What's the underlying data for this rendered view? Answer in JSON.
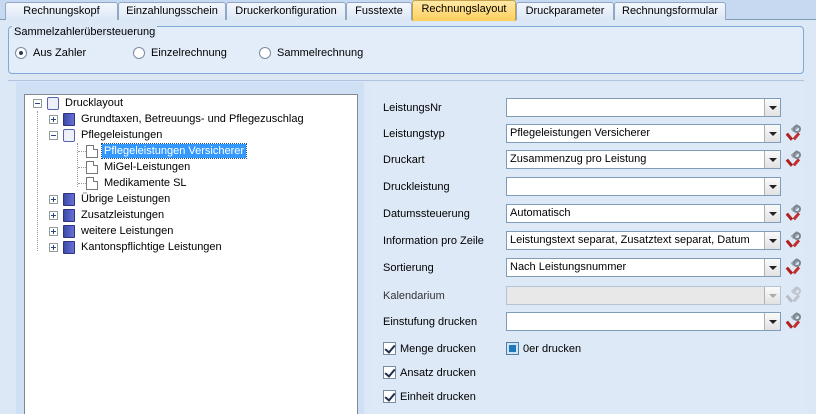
{
  "tabs": [
    {
      "label": "Rechnungskopf"
    },
    {
      "label": "Einzahlungsschein"
    },
    {
      "label": "Druckerkonfiguration"
    },
    {
      "label": "Fusstexte"
    },
    {
      "label": "Rechnungslayout"
    },
    {
      "label": "Druckparameter"
    },
    {
      "label": "Rechnungsformular"
    }
  ],
  "active_tab": "Rechnungslayout",
  "sammelzahler": {
    "title": "Sammelzahlerübersteuerung",
    "options": [
      {
        "label": "Aus Zahler",
        "selected": true
      },
      {
        "label": "Einzelrechnung",
        "selected": false
      },
      {
        "label": "Sammelrechnung",
        "selected": false
      }
    ]
  },
  "tree": {
    "root": "Drucklayout",
    "items": [
      {
        "label": "Grundtaxen, Betreuungs- und Pflegezuschlag"
      },
      {
        "label": "Pflegeleistungen"
      },
      {
        "label": "Pflegeleistungen Versicherer",
        "selected": true
      },
      {
        "label": "MiGel-Leistungen"
      },
      {
        "label": "Medikamente SL"
      },
      {
        "label": "Übrige Leistungen"
      },
      {
        "label": "Zusatzleistungen"
      },
      {
        "label": "weitere Leistungen"
      },
      {
        "label": "Kantonspflichtige Leistungen"
      }
    ]
  },
  "fields": [
    {
      "label": "LeistungsNr",
      "value": ""
    },
    {
      "label": "Leistungstyp",
      "value": "Pflegeleistungen Versicherer"
    },
    {
      "label": "Druckart",
      "value": "Zusammenzug pro Leistung"
    },
    {
      "label": "Druckleistung",
      "value": ""
    },
    {
      "label": "Datumssteuerung",
      "value": "Automatisch"
    },
    {
      "label": "Information pro Zeile",
      "value": "Leistungstext separat, Zusatztext separat, Datum"
    },
    {
      "label": "Sortierung",
      "value": "Nach Leistungsnummer"
    },
    {
      "label": "Kalendarium",
      "value": "",
      "disabled": true
    },
    {
      "label": "Einstufung drucken",
      "value": ""
    }
  ],
  "checkboxes": [
    {
      "label": "Menge drucken",
      "checked": true
    },
    {
      "label": "0er drucken",
      "checked": false
    },
    {
      "label": "Ansatz drucken",
      "checked": true
    },
    {
      "label": "Einheit drucken",
      "checked": true
    }
  ],
  "icons": {
    "tool_button": "hammer-wrench-icon",
    "dropdown": "chevron-down-icon",
    "folder_closed": "book-icon",
    "folder_open": "open-book-icon",
    "leaf": "document-icon"
  },
  "colors": {
    "active_tab": "#ffcf5c",
    "selection": "#3399ff",
    "panel_bg": "#dce8f6"
  }
}
